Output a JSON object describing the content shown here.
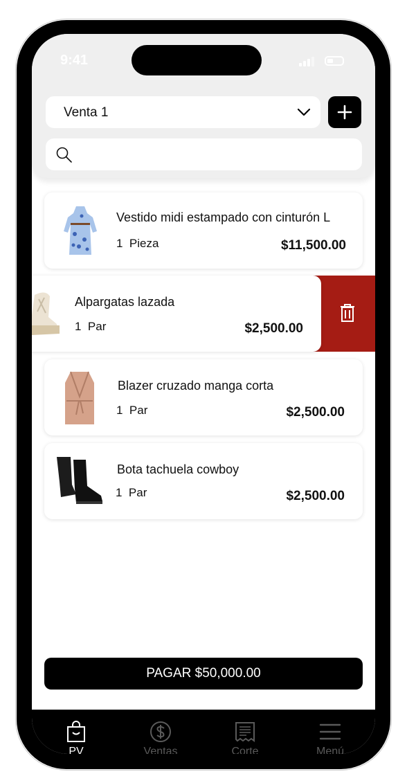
{
  "status": {
    "time": "9:41"
  },
  "header": {
    "sale_selector": "Venta 1",
    "search_placeholder": ""
  },
  "cart": {
    "items": [
      {
        "name": "Vestido midi estampado con cinturón L",
        "qty": "1",
        "unit": "Pieza",
        "price": "$11,500.00"
      },
      {
        "name": "Alpargatas lazada",
        "qty": "1",
        "unit": "Par",
        "price": "$2,500.00"
      },
      {
        "name": "Blazer cruzado manga corta",
        "qty": "1",
        "unit": "Par",
        "price": "$2,500.00"
      },
      {
        "name": "Bota tachuela cowboy",
        "qty": "1",
        "unit": "Par",
        "price": "$2,500.00"
      }
    ]
  },
  "pay_button": "PAGAR $50,000.00",
  "tabs": [
    {
      "label": "PV",
      "icon": "shopping-bag-icon",
      "active": true
    },
    {
      "label": "Ventas",
      "icon": "dollar-circle-icon",
      "active": false
    },
    {
      "label": "Corte",
      "icon": "receipt-icon",
      "active": false
    },
    {
      "label": "Menú",
      "icon": "menu-icon",
      "active": false
    }
  ],
  "colors": {
    "delete": "#a51c14",
    "primary": "#000000",
    "header_bg": "#efefef"
  }
}
